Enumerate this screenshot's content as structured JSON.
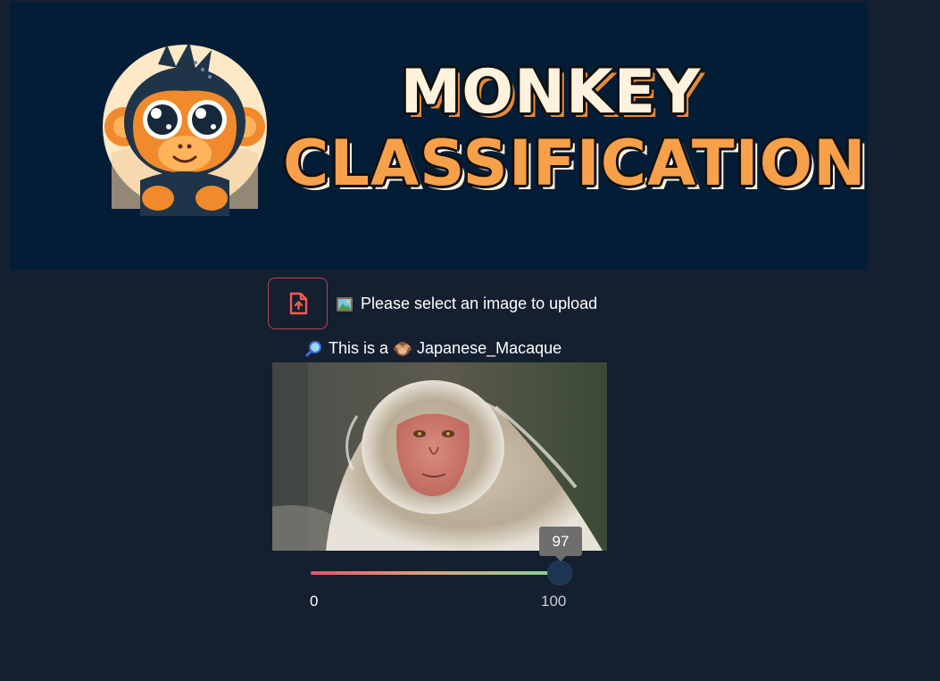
{
  "banner": {
    "title_line1": "MONKEY",
    "title_line2": "CLASSIFICATION"
  },
  "upload": {
    "button_icon": "file-upload-icon",
    "prompt": "Please select an image to upload",
    "prompt_icon": "framed-picture-icon"
  },
  "result": {
    "prefix": "This is a",
    "label": "Japanese_Macaque",
    "search_icon": "magnifying-glass-icon",
    "monkey_icon": "see-no-evil-monkey-icon"
  },
  "confidence_slider": {
    "value": "97",
    "min": "0",
    "max": "100",
    "fraction": 0.97
  },
  "colors": {
    "background": "#141f2f",
    "banner": "#041d37",
    "accent_red": "#b4474d",
    "title_orange": "#f7a04a",
    "title_cream": "#fff3de"
  }
}
